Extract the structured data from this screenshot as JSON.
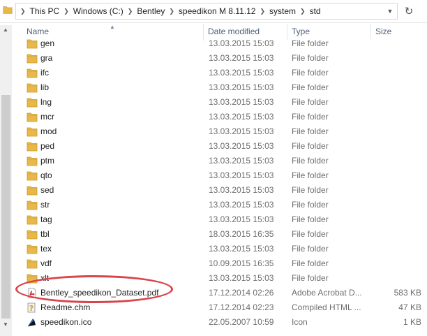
{
  "address_bar": {
    "crumbs": [
      "This PC",
      "Windows (C:)",
      "Bentley",
      "speedikon M 8.11.12",
      "system",
      "std"
    ],
    "dropdown_icon": "chevron-down-icon",
    "refresh_icon": "refresh-icon"
  },
  "columns": {
    "name": "Name",
    "date": "Date modified",
    "type": "Type",
    "size": "Size"
  },
  "files": [
    {
      "name": "gen",
      "date": "13.03.2015 15:03",
      "type": "File folder",
      "size": "",
      "icon": "folder-icon"
    },
    {
      "name": "gra",
      "date": "13.03.2015 15:03",
      "type": "File folder",
      "size": "",
      "icon": "folder-icon"
    },
    {
      "name": "ifc",
      "date": "13.03.2015 15:03",
      "type": "File folder",
      "size": "",
      "icon": "folder-icon"
    },
    {
      "name": "lib",
      "date": "13.03.2015 15:03",
      "type": "File folder",
      "size": "",
      "icon": "folder-icon"
    },
    {
      "name": "lng",
      "date": "13.03.2015 15:03",
      "type": "File folder",
      "size": "",
      "icon": "folder-icon"
    },
    {
      "name": "mcr",
      "date": "13.03.2015 15:03",
      "type": "File folder",
      "size": "",
      "icon": "folder-icon"
    },
    {
      "name": "mod",
      "date": "13.03.2015 15:03",
      "type": "File folder",
      "size": "",
      "icon": "folder-icon"
    },
    {
      "name": "ped",
      "date": "13.03.2015 15:03",
      "type": "File folder",
      "size": "",
      "icon": "folder-icon"
    },
    {
      "name": "ptm",
      "date": "13.03.2015 15:03",
      "type": "File folder",
      "size": "",
      "icon": "folder-icon"
    },
    {
      "name": "qto",
      "date": "13.03.2015 15:03",
      "type": "File folder",
      "size": "",
      "icon": "folder-icon"
    },
    {
      "name": "sed",
      "date": "13.03.2015 15:03",
      "type": "File folder",
      "size": "",
      "icon": "folder-icon"
    },
    {
      "name": "str",
      "date": "13.03.2015 15:03",
      "type": "File folder",
      "size": "",
      "icon": "folder-icon"
    },
    {
      "name": "tag",
      "date": "13.03.2015 15:03",
      "type": "File folder",
      "size": "",
      "icon": "folder-icon"
    },
    {
      "name": "tbl",
      "date": "18.03.2015 16:35",
      "type": "File folder",
      "size": "",
      "icon": "folder-icon"
    },
    {
      "name": "tex",
      "date": "13.03.2015 15:03",
      "type": "File folder",
      "size": "",
      "icon": "folder-icon"
    },
    {
      "name": "vdf",
      "date": "10.09.2015 16:35",
      "type": "File folder",
      "size": "",
      "icon": "folder-icon"
    },
    {
      "name": "xlt",
      "date": "13.03.2015 15:03",
      "type": "File folder",
      "size": "",
      "icon": "folder-icon"
    },
    {
      "name": "Bentley_speedikon_Dataset.pdf",
      "date": "17.12.2014 02:26",
      "type": "Adobe Acrobat D...",
      "size": "583 KB",
      "icon": "pdf-icon"
    },
    {
      "name": "Readme.chm",
      "date": "17.12.2014 02:23",
      "type": "Compiled HTML ...",
      "size": "47 KB",
      "icon": "help-file-icon"
    },
    {
      "name": "speedikon.ico",
      "date": "22.05.2007 10:59",
      "type": "Icon",
      "size": "1 KB",
      "icon": "icon-file-icon"
    }
  ],
  "accent_colors": {
    "annotation": "#d9434a",
    "folder": "#e8b84a",
    "header_text": "#4c607a"
  }
}
